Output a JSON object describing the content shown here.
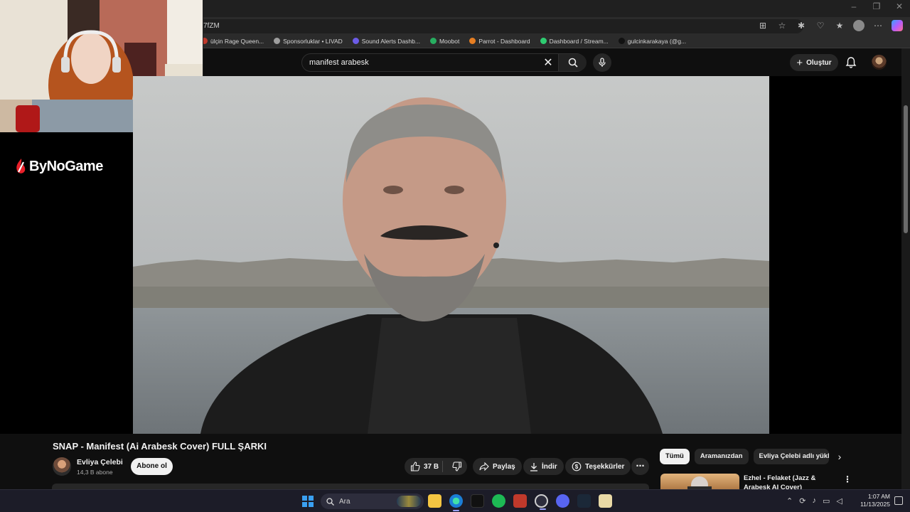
{
  "browser": {
    "url_fragment": "7fZM",
    "bookmarks": [
      {
        "label": "ülçin Rage Queen...",
        "color": "#c0392b"
      },
      {
        "label": "Sponsorluklar • LIVAD",
        "color": "#9e9e9e"
      },
      {
        "label": "Sound Alerts Dashb...",
        "color": "#6c5ce7"
      },
      {
        "label": "Moobot",
        "color": "#27ae60"
      },
      {
        "label": "Parrot - Dashboard",
        "color": "#e67e22"
      },
      {
        "label": "Dashboard / Stream...",
        "color": "#2ecc71"
      },
      {
        "label": "gulcinkarakaya (@g...",
        "color": "#111111"
      }
    ],
    "window_controls": [
      "–",
      "❐",
      "✕"
    ]
  },
  "overlay": {
    "logo_text": "ByNoGame"
  },
  "youtube": {
    "search": {
      "value": "manifest arabesk"
    },
    "create_label": "Oluştur",
    "video": {
      "title": "SNAP - Manifest (Ai Arabesk Cover) FULL ŞARKI",
      "channel_name": "Evliya Çelebi",
      "subscribers": "14,3 B abone",
      "subscribe_label": "Abone ol",
      "likes": "37 B",
      "share_label": "Paylaş",
      "download_label": "İndir",
      "thanks_label": "Teşekkürler"
    },
    "chips": [
      {
        "label": "Tümü",
        "active": true
      },
      {
        "label": "Aramanızdan",
        "active": false
      },
      {
        "label": "Evliya Çelebi adlı yükleyi",
        "active": false
      }
    ],
    "recommendation": {
      "title": "Ezhel - Felaket (Jazz & Arabesk AI Cover)"
    }
  },
  "taskbar": {
    "search_label": "Ara",
    "time": "1:07 AM",
    "date": "11/13/2025"
  }
}
